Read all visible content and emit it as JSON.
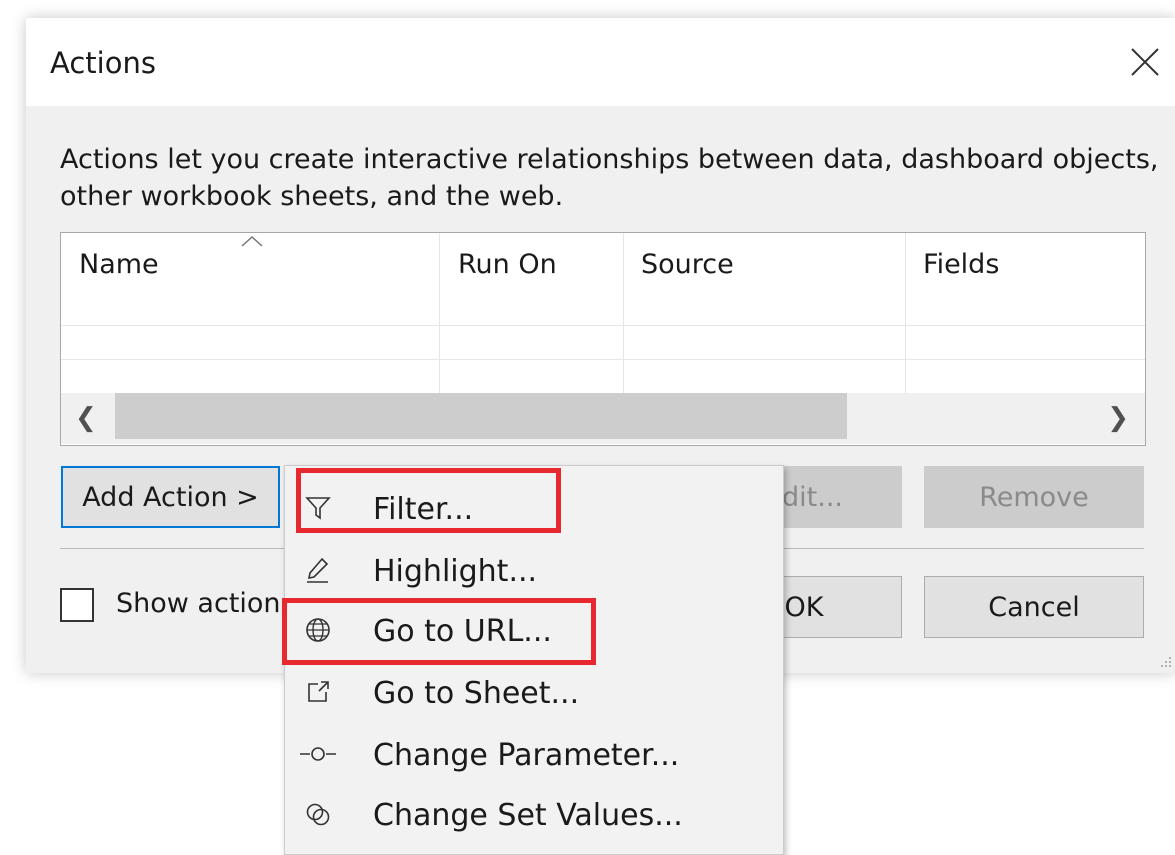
{
  "dialog": {
    "title": "Actions",
    "description": "Actions let you create interactive relationships between data, dashboard objects, other workbook sheets, and the web."
  },
  "table": {
    "columns": [
      "Name",
      "Run On",
      "Source",
      "Fields"
    ]
  },
  "buttons": {
    "add_action": "Add Action >",
    "edit": "Edit...",
    "remove": "Remove",
    "ok": "OK",
    "cancel": "Cancel"
  },
  "checkbox": {
    "label": "Show actions for all sheets",
    "checked": false
  },
  "menu": {
    "items": [
      {
        "label": "Filter...",
        "icon": "funnel-icon"
      },
      {
        "label": "Highlight...",
        "icon": "highlighter-icon"
      },
      {
        "label": "Go to URL...",
        "icon": "globe-icon"
      },
      {
        "label": "Go to Sheet...",
        "icon": "external-link-icon"
      },
      {
        "label": "Change Parameter...",
        "icon": "parameter-icon"
      },
      {
        "label": "Change Set Values...",
        "icon": "set-values-icon"
      }
    ]
  },
  "colors": {
    "highlight": "#e8282f",
    "focus": "#0078d7"
  }
}
